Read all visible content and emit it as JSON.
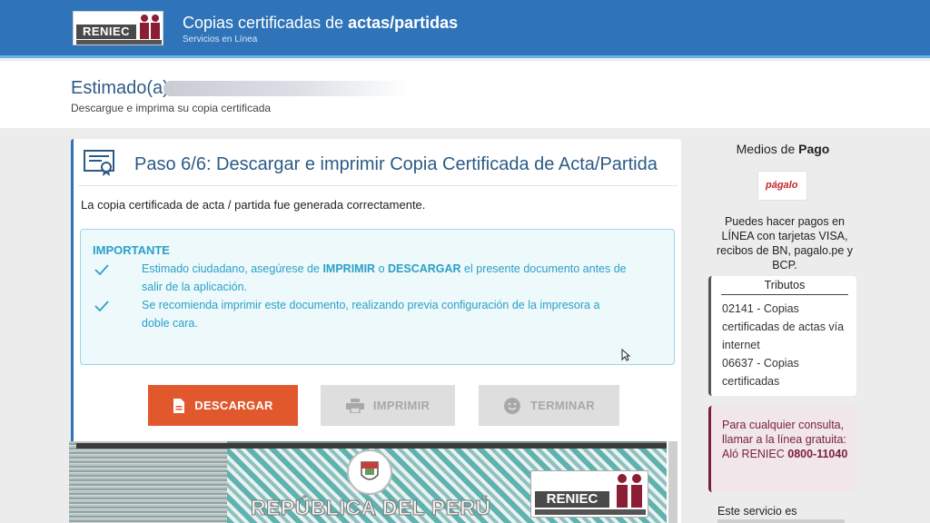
{
  "header": {
    "logo_text": "RENIEC",
    "title_prefix": "Copias certificadas de ",
    "title_bold": "actas/partidas",
    "subtitle": "Servicios en Línea"
  },
  "greeting": {
    "title": "Estimado(a)",
    "subtitle": "Descargue e imprima su copia certificada"
  },
  "step": {
    "title": "Paso 6/6: Descargar e imprimir Copia Certificada de Acta/Partida",
    "success_message": "La copia certificada de acta / partida fue generada correctamente."
  },
  "important": {
    "heading": "IMPORTANTE",
    "item1_a": "Estimado ciudadano, asegúrese de ",
    "item1_b": "IMPRIMIR",
    "item1_c": " o ",
    "item1_d": "DESCARGAR",
    "item1_e": " el presente documento antes de",
    "item1_f": "salir de la aplicación.",
    "item2_a": "Se recomienda imprimir este documento, realizando previa configuración de la impresora a",
    "item2_b": "doble cara."
  },
  "actions": {
    "download": "DESCARGAR",
    "print": "IMPRIMIR",
    "finish": "TERMINAR"
  },
  "document": {
    "country": "REPÚBLICA DEL PERÚ",
    "logo_text": "RENIEC"
  },
  "sidebar": {
    "medios_prefix": "Medios de ",
    "medios_bold": "Pago",
    "pagalo_logo": "págalo",
    "payment_info": "Puedes hacer pagos en LÍNEA con tarjetas VISA, recibos de BN, pagalo.pe y BCP.",
    "tributos_title": "Tributos",
    "tributo1": "02141 - Copias certificadas de actas vía internet",
    "tributo2": "06637 - Copias certificadas",
    "consulta_text": "Para cualquier consulta, llamar a la línea gratuita: Aló RENIEC ",
    "consulta_phone": "0800-11040",
    "servicio": "Este servicio es"
  },
  "colors": {
    "header_blue": "#2f74b9",
    "download_orange": "#e0582b",
    "info_cyan": "#2aa0c7",
    "consulta_maroon": "#7a1f3c"
  }
}
